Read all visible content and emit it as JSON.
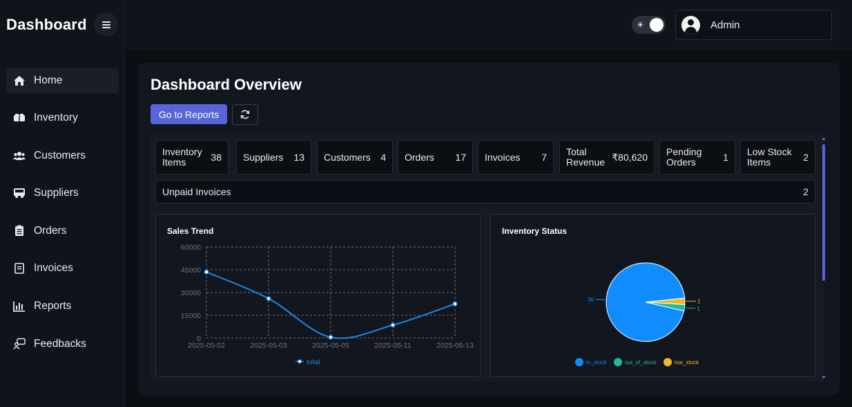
{
  "sidebar": {
    "brand": "Dashboard",
    "items": [
      {
        "label": "Home",
        "icon": "home-icon"
      },
      {
        "label": "Inventory",
        "icon": "boxes-icon"
      },
      {
        "label": "Customers",
        "icon": "users-icon"
      },
      {
        "label": "Suppliers",
        "icon": "truck-icon"
      },
      {
        "label": "Orders",
        "icon": "clipboard-icon"
      },
      {
        "label": "Invoices",
        "icon": "invoice-icon"
      },
      {
        "label": "Reports",
        "icon": "bar-chart-icon"
      },
      {
        "label": "Feedbacks",
        "icon": "feedback-icon"
      }
    ]
  },
  "header": {
    "user": "Admin",
    "theme_icon": "☀"
  },
  "main": {
    "title": "Dashboard Overview",
    "reports_button": "Go to Reports",
    "stats": [
      {
        "label": "Inventory Items",
        "value": "38"
      },
      {
        "label": "Suppliers",
        "value": "13"
      },
      {
        "label": "Customers",
        "value": "4"
      },
      {
        "label": "Orders",
        "value": "17"
      },
      {
        "label": "Invoices",
        "value": "7"
      },
      {
        "label": "Total Revenue",
        "value": "₹80,620"
      },
      {
        "label": "Pending Orders",
        "value": "1"
      },
      {
        "label": "Low Stock Items",
        "value": "2"
      }
    ],
    "unpaid": {
      "label": "Unpaid Invoices",
      "value": "2"
    }
  },
  "colors": {
    "accent": "#5865d8",
    "line": "#1e88e5",
    "in_stock": "#0f8cff",
    "out_of_stock": "#1abc9c",
    "low_stock": "#f5b62a"
  },
  "chart_data": [
    {
      "type": "line",
      "title": "Sales Trend",
      "x": [
        "2025-05-02",
        "2025-05-03",
        "2025-05-05",
        "2025-05-11",
        "2025-05-13"
      ],
      "series": [
        {
          "name": "total",
          "values": [
            43500,
            26000,
            500,
            8500,
            22500
          ]
        }
      ],
      "yticks": [
        0,
        15000,
        30000,
        45000,
        60000
      ],
      "ylim": [
        0,
        60000
      ],
      "grid": true,
      "legend": "bottom"
    },
    {
      "type": "pie",
      "title": "Inventory Status",
      "labels": [
        "in_stock",
        "out_of_stock",
        "low_stock"
      ],
      "values": [
        36,
        1,
        1
      ],
      "legend": "bottom"
    }
  ]
}
